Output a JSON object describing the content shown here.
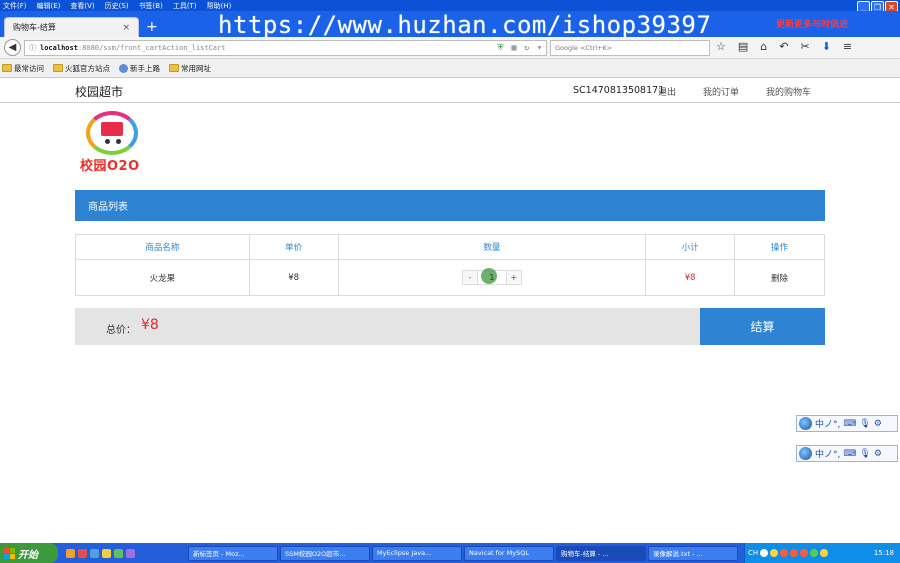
{
  "browser": {
    "menu": [
      "文件(F)",
      "编辑(E)",
      "查看(V)",
      "历史(S)",
      "书签(B)",
      "工具(T)",
      "帮助(H)"
    ],
    "tab_title": "购物车-结算",
    "tab_close": "×",
    "new_tab": "+",
    "watermark": "https://www.huzhan.com/ishop39397",
    "notice": "更新更多与时俱进",
    "url_info": "ⓘ",
    "url_host": "localhost",
    "url_path": ":8080/ssm/front_cartAction_listCart",
    "search_placeholder": "Google <Ctrl+K>",
    "bookmarks": [
      "最常访问",
      "火狐官方站点",
      "新手上路",
      "常用网址"
    ]
  },
  "site": {
    "title": "校园超市",
    "user": "SC1470813508171",
    "logout": "退出",
    "my_orders": "我的订单",
    "my_cart": "我的购物车",
    "logo_text": "校园O2O"
  },
  "cart": {
    "section_title": "商品列表",
    "headers": {
      "name": "商品名称",
      "price": "单价",
      "qty": "数量",
      "subtotal": "小计",
      "op": "操作"
    },
    "items": [
      {
        "name": "火龙果",
        "price": "¥8",
        "qty": "1",
        "subtotal": "¥8",
        "op": "删除"
      }
    ],
    "minus": "-",
    "plus": "+",
    "total_label": "总价：",
    "total_value": "¥8",
    "checkout": "结算"
  },
  "ime": {
    "label": "中ノ°,"
  },
  "taskbar": {
    "start": "开始",
    "tasks": [
      "新标签页 - Moz...",
      "SSM校园O2O超市...",
      "MyEclipse Java...",
      "Navicat for MySQL",
      "购物车-结算 - ...",
      "录像解说.txt - ..."
    ],
    "tray_text": "CH",
    "clock": "15:18"
  },
  "colors": {
    "accent": "#2e84d2",
    "price_red": "#e32a2a",
    "titlebar": "#0b52d6",
    "taskbar": "#245edb"
  }
}
